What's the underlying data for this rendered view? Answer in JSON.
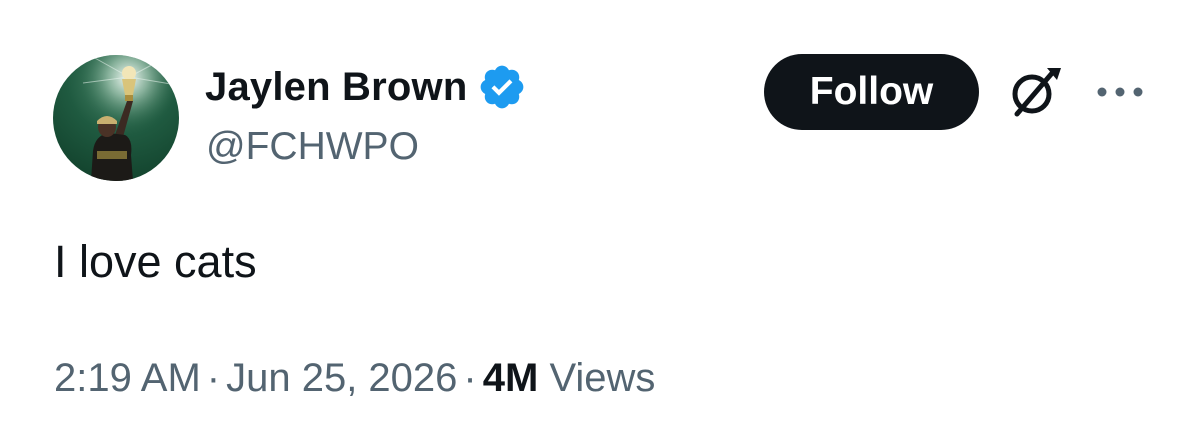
{
  "author": {
    "display_name": "Jaylen Brown",
    "handle": "@FCHWPO",
    "verified": true,
    "avatar_icon": "avatar-trophy-player",
    "verified_color": "#1d9bf0"
  },
  "actions": {
    "follow_label": "Follow",
    "grok_icon": "grok-icon",
    "more_icon": "more-icon"
  },
  "tweet": {
    "text": "I love cats"
  },
  "meta": {
    "time": "2:19 AM",
    "separator": "·",
    "date": "Jun 25, 2026",
    "views_count": "4M",
    "views_label": "Views"
  },
  "colors": {
    "text_primary": "#0f1419",
    "text_secondary": "#536471",
    "follow_bg": "#0f1419",
    "follow_text": "#ffffff"
  }
}
